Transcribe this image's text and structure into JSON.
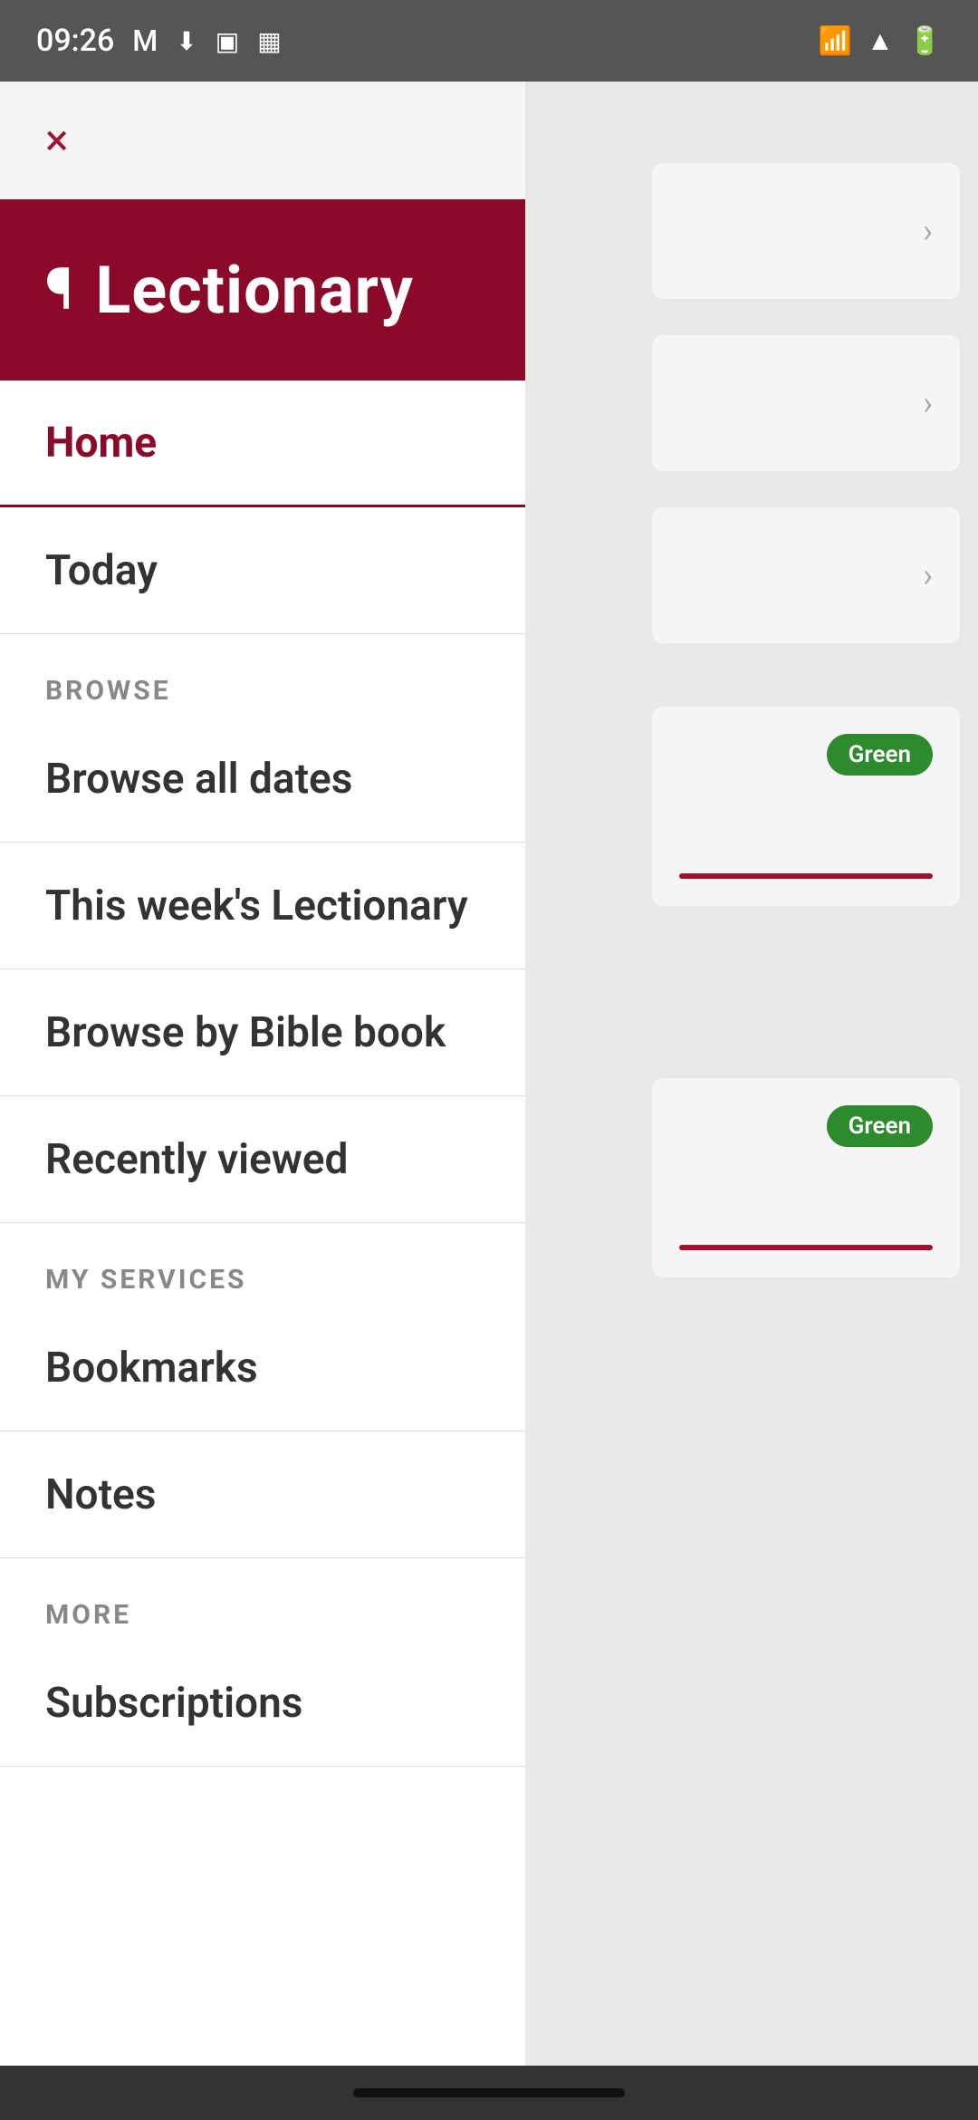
{
  "statusBar": {
    "time": "09:26",
    "icons": [
      "gmail",
      "download",
      "wallet",
      "calendar",
      "wifi",
      "signal",
      "battery"
    ]
  },
  "drawer": {
    "closeLabel": "×",
    "header": {
      "icon": "¶",
      "title": "Lectionary"
    },
    "navItems": [
      {
        "type": "item",
        "label": "Home",
        "active": true,
        "id": "home"
      },
      {
        "type": "item",
        "label": "Today",
        "active": false,
        "id": "today"
      },
      {
        "type": "section",
        "label": "BROWSE"
      },
      {
        "type": "item",
        "label": "Browse all dates",
        "active": false,
        "id": "browse-all-dates"
      },
      {
        "type": "item",
        "label": "This week's Lectionary",
        "active": false,
        "id": "this-weeks-lectionary"
      },
      {
        "type": "item",
        "label": "Browse by Bible book",
        "active": false,
        "id": "browse-by-bible-book"
      },
      {
        "type": "item",
        "label": "Recently viewed",
        "active": false,
        "id": "recently-viewed"
      },
      {
        "type": "section",
        "label": "MY SERVICES"
      },
      {
        "type": "item",
        "label": "Bookmarks",
        "active": false,
        "id": "bookmarks"
      },
      {
        "type": "item",
        "label": "Notes",
        "active": false,
        "id": "notes"
      },
      {
        "type": "section",
        "label": "MORE"
      },
      {
        "type": "item",
        "label": "Subscriptions",
        "active": false,
        "id": "subscriptions"
      }
    ]
  },
  "backgroundCards": {
    "greenBadge": "Green"
  }
}
